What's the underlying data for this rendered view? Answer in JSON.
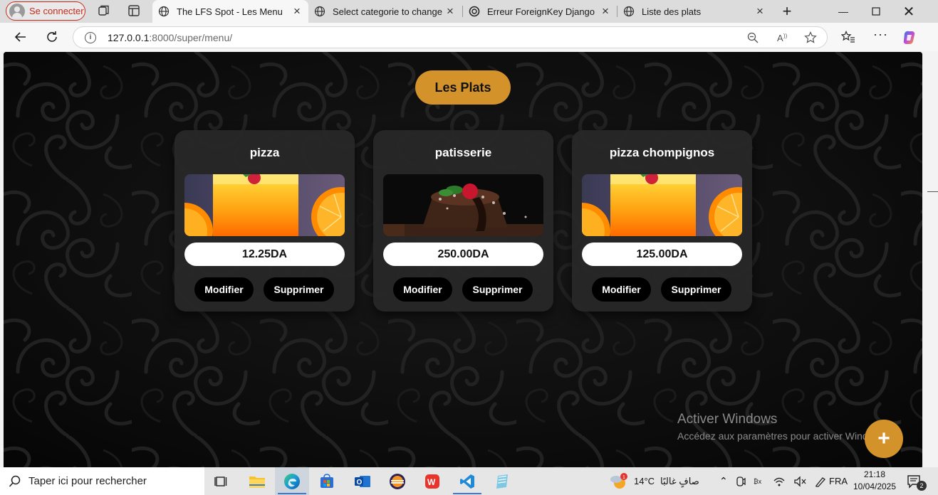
{
  "browser": {
    "profile_label": "Se connecter",
    "tabs": [
      {
        "title": "The LFS Spot - Les Menu",
        "active": true
      },
      {
        "title": "Select categorie to change | D",
        "active": false
      },
      {
        "title": "Erreur ForeignKey Django",
        "active": false
      },
      {
        "title": "Liste des plats",
        "active": false
      }
    ],
    "url_host": "127.0.0.1",
    "url_rest": ":8000/super/menu/"
  },
  "page": {
    "title": "Les Plats",
    "cards": [
      {
        "name": "pizza",
        "price": "12.25DA",
        "image": "orange-juice",
        "edit_label": "Modifier",
        "delete_label": "Supprimer"
      },
      {
        "name": "patisserie",
        "price": "250.00DA",
        "image": "chocolate-cake",
        "edit_label": "Modifier",
        "delete_label": "Supprimer"
      },
      {
        "name": "pizza chompignos",
        "price": "125.00DA",
        "image": "orange-juice",
        "edit_label": "Modifier",
        "delete_label": "Supprimer"
      }
    ],
    "fab_label": "+",
    "accent_color": "#d4922a"
  },
  "watermark": {
    "line1": "Activer Windows",
    "line2": "Accédez aux paramètres pour activer Windows."
  },
  "taskbar": {
    "search_placeholder": "Taper ici pour rechercher",
    "weather_temp": "14°C",
    "weather_text": "صافٍ غالبًا",
    "weather_badge": "1",
    "language": "FRA",
    "time": "21:18",
    "date": "10/04/2025",
    "notifications": "2"
  }
}
